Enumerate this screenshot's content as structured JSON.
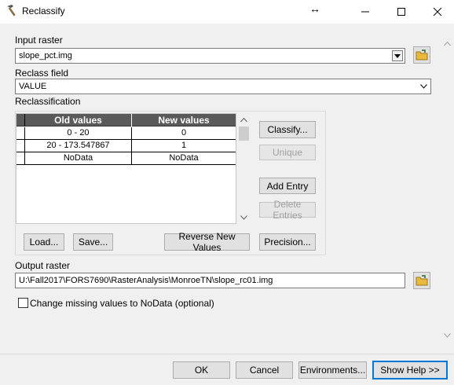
{
  "window": {
    "title": "Reclassify",
    "controls": [
      "minimize-icon",
      "maximize-icon",
      "close-icon"
    ]
  },
  "input_raster": {
    "label": "Input raster",
    "value": "slope_pct.img"
  },
  "reclass_field": {
    "label": "Reclass field",
    "value": "VALUE"
  },
  "reclassification": {
    "label": "Reclassification",
    "columns": [
      "Old values",
      "New values"
    ],
    "rows": [
      {
        "old": "0 - 20",
        "new": "0"
      },
      {
        "old": "20 - 173.547867",
        "new": "1"
      },
      {
        "old": "NoData",
        "new": "NoData"
      }
    ],
    "buttons": {
      "classify": "Classify...",
      "unique": "Unique",
      "add_entry": "Add Entry",
      "delete_entries": "Delete Entries",
      "load": "Load...",
      "save": "Save...",
      "reverse": "Reverse New Values",
      "precision": "Precision..."
    }
  },
  "output_raster": {
    "label": "Output raster",
    "value": "U:\\Fall2017\\FORS7690\\RasterAnalysis\\MonroeTN\\slope_rc01.img"
  },
  "missing_nodata": {
    "label": "Change missing values to NoData (optional)",
    "checked": false
  },
  "footer": {
    "ok": "OK",
    "cancel": "Cancel",
    "environments": "Environments...",
    "show_help": "Show Help >>"
  },
  "colors": {
    "accent": "#0078d7",
    "header_bg": "#5a5a5a",
    "dialog_bg": "#f0f0f0"
  }
}
